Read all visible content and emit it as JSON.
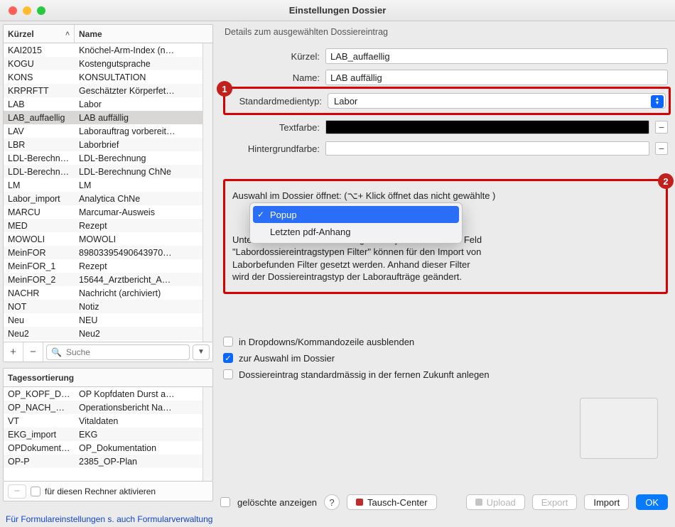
{
  "window": {
    "title": "Einstellungen Dossier"
  },
  "left": {
    "columns": {
      "code": "Kürzel",
      "name": "Name"
    },
    "rows": [
      {
        "code": "KAI2015",
        "name": "Knöchel-Arm-Index (n…"
      },
      {
        "code": "KOGU",
        "name": "Kostengutsprache"
      },
      {
        "code": "KONS",
        "name": "KONSULTATION"
      },
      {
        "code": "KRPRFTT",
        "name": "Geschätzter Körperfet…"
      },
      {
        "code": "LAB",
        "name": "Labor"
      },
      {
        "code": "LAB_auffaellig",
        "name": "LAB auffällig",
        "selected": true
      },
      {
        "code": "LAV",
        "name": "Laborauftrag vorbereit…"
      },
      {
        "code": "LBR",
        "name": "Laborbrief"
      },
      {
        "code": "LDL-Berechn…",
        "name": "LDL-Berechnung"
      },
      {
        "code": "LDL-Berechn…",
        "name": "LDL-Berechnung ChNe"
      },
      {
        "code": "LM",
        "name": "LM"
      },
      {
        "code": "Labor_import",
        "name": "Analytica ChNe"
      },
      {
        "code": "MARCU",
        "name": "Marcumar-Ausweis"
      },
      {
        "code": "MED",
        "name": "Rezept"
      },
      {
        "code": "MOWOLI",
        "name": "MOWOLI"
      },
      {
        "code": "MeinFOR",
        "name": "89803395490643970…"
      },
      {
        "code": "MeinFOR_1",
        "name": "Rezept"
      },
      {
        "code": "MeinFOR_2",
        "name": "15644_Arztbericht_A…"
      },
      {
        "code": "NACHR",
        "name": "Nachricht (archiviert)"
      },
      {
        "code": "NOT",
        "name": "Notiz"
      },
      {
        "code": "Neu",
        "name": "NEU"
      },
      {
        "code": "Neu2",
        "name": "Neu2"
      }
    ],
    "toolbar": {
      "add": "+",
      "remove": "−",
      "search_placeholder": "Suche",
      "dropdown": "▼"
    },
    "bottom_header": "Tagessortierung",
    "bottom_rows": [
      {
        "code": "OP_KOPF_DU…",
        "name": "OP Kopfdaten Durst a…"
      },
      {
        "code": "OP_NACH_D…",
        "name": "Operationsbericht Na…"
      },
      {
        "code": "VT",
        "name": "Vitaldaten"
      },
      {
        "code": "EKG_import",
        "name": "EKG"
      },
      {
        "code": "OPDokument…",
        "name": "OP_Dokumentation"
      },
      {
        "code": "OP-P",
        "name": "2385_OP-Plan"
      }
    ],
    "footer": {
      "remove_btn": "−",
      "activate_label": "für diesen Rechner aktivieren"
    }
  },
  "detail": {
    "section_label": "Details zum ausgewählten Dossiereintrag",
    "labels": {
      "kuerzel": "Kürzel:",
      "name": "Name:",
      "medientyp": "Standardmedientyp:",
      "textfarbe": "Textfarbe:",
      "hintergrund": "Hintergrundfarbe:"
    },
    "values": {
      "kuerzel": "LAB_auffaellig",
      "name": "LAB auffällig",
      "medientyp": "Labor"
    },
    "badges": {
      "one": "1",
      "two": "2"
    },
    "popup_line": "Auswahl im Dossier öffnet: (⌥+ Klick öffnet das nicht gewählte )",
    "dropdown": {
      "items": [
        {
          "label": "Popup",
          "selected": true
        },
        {
          "label": "Letzten pdf-Anhang",
          "selected": false
        }
      ]
    },
    "desc_lines": [
      "Unter Admin -> Laboreinstellungen -> System/Server im Feld",
      "\"Labordossiereintragstypen Filter\" können für den Import von",
      "Laborbefunden Filter gesetzt werden. Anhand dieser Filter",
      "wird der Dossiereintragstyp der Laboraufträge geändert."
    ],
    "checks": {
      "hide": "in Dropdowns/Kommandozeile ausblenden",
      "auswahl": "zur Auswahl im Dossier",
      "future": "Dossiereintrag standardmässig in der fernen Zukunft anlegen"
    }
  },
  "footer": {
    "deleted": "gelöschte anzeigen",
    "tausch": "Tausch-Center",
    "upload": "Upload",
    "export": "Export",
    "import": "Import",
    "ok": "OK"
  },
  "link": "Für Formulareinstellungen s. auch Formularverwaltung"
}
